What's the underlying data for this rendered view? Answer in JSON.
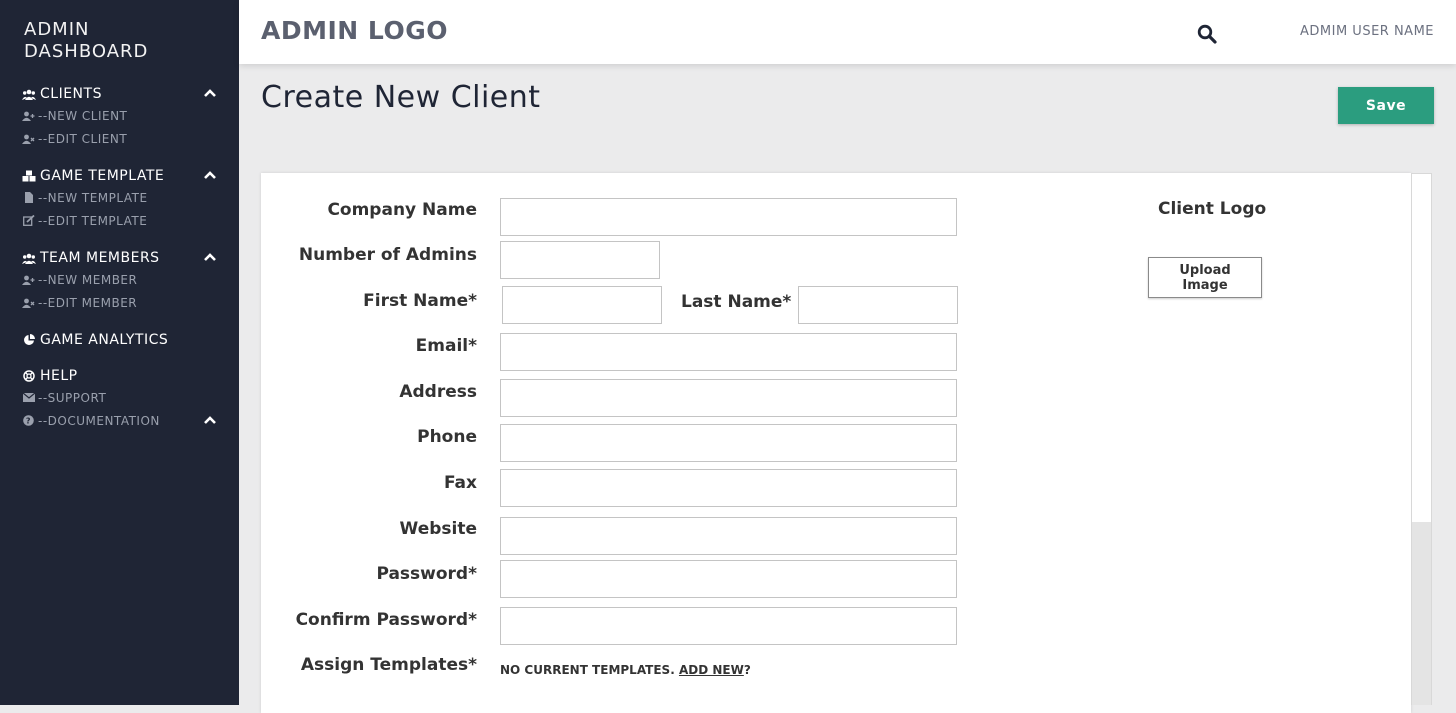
{
  "sidebar": {
    "title_line1": "ADMIN",
    "title_line2": "DASHBOARD",
    "sections": [
      {
        "label": "CLIENTS",
        "items": [
          "--NEW CLIENT",
          "--EDIT CLIENT"
        ]
      },
      {
        "label": "GAME TEMPLATE",
        "items": [
          "--NEW TEMPLATE",
          "--EDIT TEMPLATE"
        ]
      },
      {
        "label": "TEAM MEMBERS",
        "items": [
          "--NEW MEMBER",
          "--EDIT MEMBER"
        ]
      },
      {
        "label": "GAME ANALYTICS",
        "items": []
      },
      {
        "label": "HELP",
        "items": [
          "--SUPPORT",
          "--DOCUMENTATION"
        ]
      }
    ]
  },
  "header": {
    "logo": "ADMIN LOGO",
    "user_name": "ADMIM USER NAME"
  },
  "page": {
    "title": "Create New Client",
    "save_label": "Save"
  },
  "form": {
    "company_name": "Company Name",
    "number_of_admins": "Number of Admins",
    "first_name": "First Name*",
    "last_name": "Last Name*",
    "email": "Email*",
    "address": "Address",
    "phone": "Phone",
    "fax": "Fax",
    "website": "Website",
    "password": "Password*",
    "confirm_password": "Confirm Password*",
    "assign_templates": "Assign Templates*",
    "templates_note": "NO CURRENT TEMPLATES.",
    "add_new_link": "ADD NEW",
    "add_new_suffix": "?",
    "client_logo": "Client Logo",
    "upload_label": "Upload Image"
  },
  "colors": {
    "sidebar_bg": "#1f2535",
    "accent": "#2b9d7f"
  }
}
